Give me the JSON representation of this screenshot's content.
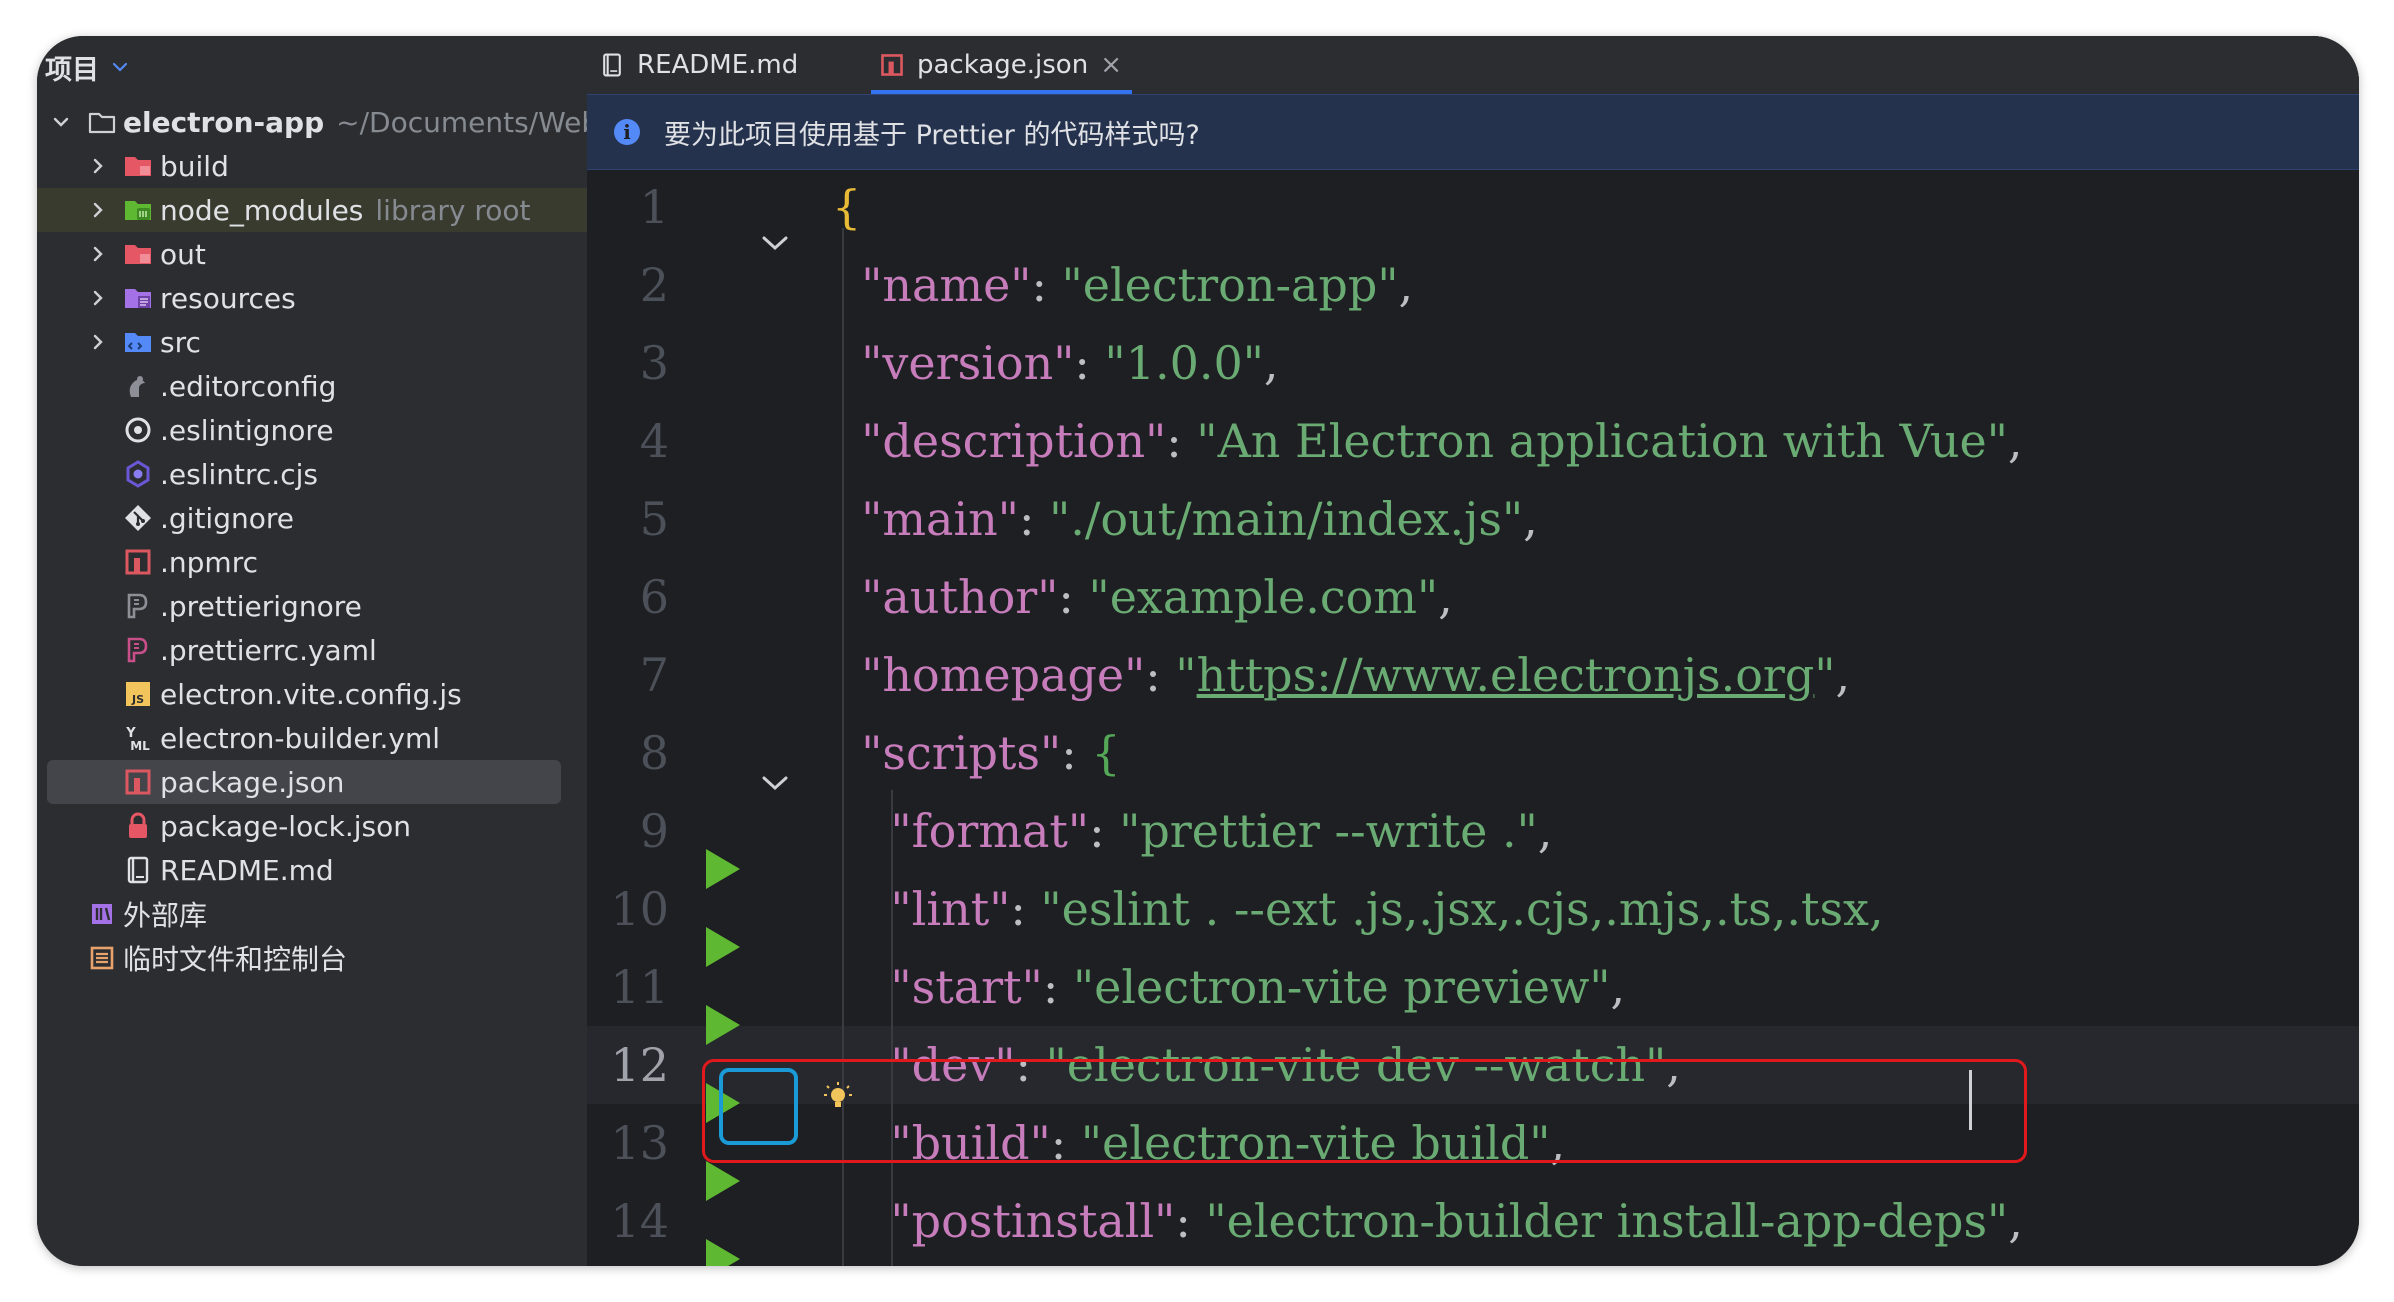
{
  "sidebar": {
    "title": "项目",
    "root": {
      "name": "electron-app",
      "path": "~/Documents/WebPr"
    },
    "items": [
      {
        "label": "build",
        "note": ""
      },
      {
        "label": "node_modules",
        "note": "library root"
      },
      {
        "label": "out",
        "note": ""
      },
      {
        "label": "resources",
        "note": ""
      },
      {
        "label": "src",
        "note": ""
      },
      {
        "label": ".editorconfig",
        "note": ""
      },
      {
        "label": ".eslintignore",
        "note": ""
      },
      {
        "label": ".eslintrc.cjs",
        "note": ""
      },
      {
        "label": ".gitignore",
        "note": ""
      },
      {
        "label": ".npmrc",
        "note": ""
      },
      {
        "label": ".prettierignore",
        "note": ""
      },
      {
        "label": ".prettierrc.yaml",
        "note": ""
      },
      {
        "label": "electron.vite.config.js",
        "note": ""
      },
      {
        "label": "electron-builder.yml",
        "note": ""
      },
      {
        "label": "package.json",
        "note": ""
      },
      {
        "label": "package-lock.json",
        "note": ""
      },
      {
        "label": "README.md",
        "note": ""
      }
    ],
    "external_libraries": "外部库",
    "scratches": "临时文件和控制台",
    "icons": {
      "js_badge": "JS",
      "yml_badge_top": "Y",
      "yml_badge_bottom": "ML"
    }
  },
  "tabs": [
    {
      "label": "README.md",
      "active": false
    },
    {
      "label": "package.json",
      "active": true,
      "close": "×"
    }
  ],
  "banner": {
    "icon": "i",
    "text": "要为此项目使用基于 Prettier 的代码样式吗?"
  },
  "editor": {
    "current_line": 12,
    "lines": [
      {
        "n": "1",
        "tokens": [
          {
            "t": "{",
            "c": "b"
          }
        ]
      },
      {
        "n": "2",
        "tokens": [
          {
            "t": "  ",
            "c": "p"
          },
          {
            "t": "\"name\"",
            "c": "k"
          },
          {
            "t": ": ",
            "c": "p"
          },
          {
            "t": "\"electron-app\"",
            "c": "s"
          },
          {
            "t": ",",
            "c": "p"
          }
        ]
      },
      {
        "n": "3",
        "tokens": [
          {
            "t": "  ",
            "c": "p"
          },
          {
            "t": "\"version\"",
            "c": "k"
          },
          {
            "t": ": ",
            "c": "p"
          },
          {
            "t": "\"1.0.0\"",
            "c": "s"
          },
          {
            "t": ",",
            "c": "p"
          }
        ]
      },
      {
        "n": "4",
        "tokens": [
          {
            "t": "  ",
            "c": "p"
          },
          {
            "t": "\"description\"",
            "c": "k"
          },
          {
            "t": ": ",
            "c": "p"
          },
          {
            "t": "\"An Electron application with Vue\"",
            "c": "s"
          },
          {
            "t": ",",
            "c": "p"
          }
        ]
      },
      {
        "n": "5",
        "tokens": [
          {
            "t": "  ",
            "c": "p"
          },
          {
            "t": "\"main\"",
            "c": "k"
          },
          {
            "t": ": ",
            "c": "p"
          },
          {
            "t": "\"./out/main/index.js\"",
            "c": "s"
          },
          {
            "t": ",",
            "c": "p"
          }
        ]
      },
      {
        "n": "6",
        "tokens": [
          {
            "t": "  ",
            "c": "p"
          },
          {
            "t": "\"author\"",
            "c": "k"
          },
          {
            "t": ": ",
            "c": "p"
          },
          {
            "t": "\"example.com\"",
            "c": "s"
          },
          {
            "t": ",",
            "c": "p"
          }
        ]
      },
      {
        "n": "7",
        "tokens": [
          {
            "t": "  ",
            "c": "p"
          },
          {
            "t": "\"homepage\"",
            "c": "k"
          },
          {
            "t": ": ",
            "c": "p"
          },
          {
            "t": "\"",
            "c": "s"
          },
          {
            "t": "https://www.electronjs.org",
            "c": "s u"
          },
          {
            "t": "\"",
            "c": "s"
          },
          {
            "t": ",",
            "c": "p"
          }
        ]
      },
      {
        "n": "8",
        "tokens": [
          {
            "t": "  ",
            "c": "p"
          },
          {
            "t": "\"scripts\"",
            "c": "k"
          },
          {
            "t": ": ",
            "c": "p"
          },
          {
            "t": "{",
            "c": "b2"
          }
        ]
      },
      {
        "n": "9",
        "tokens": [
          {
            "t": "    ",
            "c": "p"
          },
          {
            "t": "\"format\"",
            "c": "k"
          },
          {
            "t": ": ",
            "c": "p"
          },
          {
            "t": "\"prettier --write .\"",
            "c": "s"
          },
          {
            "t": ",",
            "c": "p"
          }
        ]
      },
      {
        "n": "10",
        "tokens": [
          {
            "t": "    ",
            "c": "p"
          },
          {
            "t": "\"lint\"",
            "c": "k"
          },
          {
            "t": ": ",
            "c": "p"
          },
          {
            "t": "\"eslint . --ext .js,.jsx,.cjs,.mjs,.ts,.tsx,",
            "c": "s"
          }
        ]
      },
      {
        "n": "11",
        "tokens": [
          {
            "t": "    ",
            "c": "p"
          },
          {
            "t": "\"start\"",
            "c": "k"
          },
          {
            "t": ": ",
            "c": "p"
          },
          {
            "t": "\"electron-vite preview\"",
            "c": "s"
          },
          {
            "t": ",",
            "c": "p"
          }
        ]
      },
      {
        "n": "12",
        "tokens": [
          {
            "t": "    ",
            "c": "p"
          },
          {
            "t": "\"dev\"",
            "c": "k"
          },
          {
            "t": ": ",
            "c": "p"
          },
          {
            "t": "\"electron-vite dev --watch\"",
            "c": "s"
          },
          {
            "t": ",",
            "c": "p"
          }
        ]
      },
      {
        "n": "13",
        "tokens": [
          {
            "t": "    ",
            "c": "p"
          },
          {
            "t": "\"build\"",
            "c": "k"
          },
          {
            "t": ": ",
            "c": "p"
          },
          {
            "t": "\"electron-vite build\"",
            "c": "s"
          },
          {
            "t": ",",
            "c": "p"
          }
        ]
      },
      {
        "n": "14",
        "tokens": [
          {
            "t": "    ",
            "c": "p"
          },
          {
            "t": "\"postinstall\"",
            "c": "k"
          },
          {
            "t": ": ",
            "c": "p"
          },
          {
            "t": "\"electron-builder install-app-deps\"",
            "c": "s"
          },
          {
            "t": ",",
            "c": "p"
          }
        ]
      }
    ]
  },
  "colors": {
    "key": "#c77dbb",
    "string": "#6aab73",
    "brace": "#e8ba36",
    "brace_nested": "#54a857",
    "run_gutter": "#5fb832",
    "highlight_red": "#e0191d",
    "highlight_blue": "#1a9ad6",
    "accent": "#3574f0"
  }
}
